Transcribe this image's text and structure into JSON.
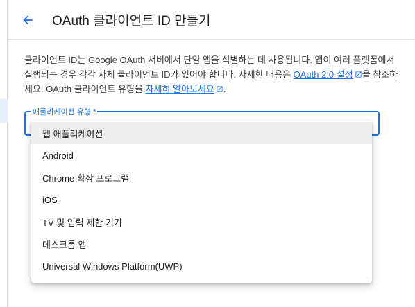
{
  "header": {
    "title": "OAuth 클라이언트 ID 만들기"
  },
  "description": {
    "text1": "클라이언트 ID는 Google OAuth 서버에서 단일 앱을 식별하는 데 사용됩니다. 앱이 여러 플랫폼에서 실행되는 경우 각각 자체 클라이언트 ID가 있어야 합니다. 자세한 내용은 ",
    "link1": "OAuth 2.0 설정",
    "text2": "을 참조하세요. OAuth 클라이언트 유형을 ",
    "link2": "자세히 알아보세요",
    "text3": "."
  },
  "field": {
    "label": "애플리케이션 유형 *"
  },
  "menu": {
    "options": [
      "웹 애플리케이션",
      "Android",
      "Chrome 확장 프로그램",
      "iOS",
      "TV 및 입력 제한 기기",
      "데스크톱 앱",
      "Universal Windows Platform(UWP)"
    ]
  },
  "colors": {
    "accent": "#1a73e8",
    "hover": "#eeeeee",
    "text": "#202124"
  },
  "icons": {
    "back": "arrow-back-icon",
    "external": "external-link-icon"
  }
}
